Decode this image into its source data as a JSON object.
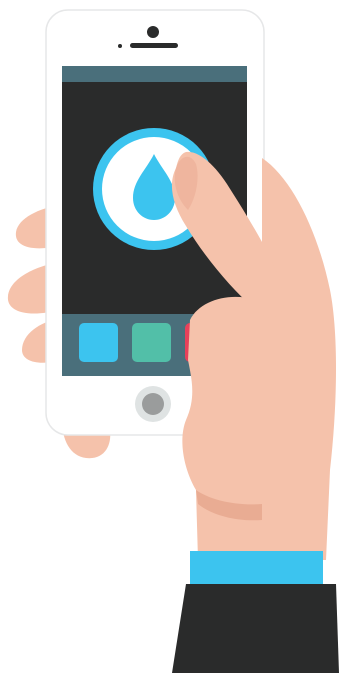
{
  "illustration": {
    "colors": {
      "background": "#ffffff",
      "phone_body": "#ffffff",
      "phone_outline": "#e6e7e8",
      "screen": "#2a2b2b",
      "status_bar": "#4a6f7b",
      "dock": "#4a6f7b",
      "accent_ring": "#3cc4ef",
      "drop": "#3cc4ef",
      "app_blue": "#3cc4ef",
      "app_green": "#52bfa8",
      "app_red": "#e8415a",
      "home_button_ring": "#dfe3e3",
      "home_button": "#9a9c9c",
      "skin": "#f5c2ab",
      "skin_shadow": "#e9ac93",
      "cuff": "#3cc4ef",
      "sleeve": "#2a2b2b"
    },
    "icons": {
      "app_icon": "water-drop-icon",
      "dock_apps": [
        "blue-app-icon",
        "green-app-icon",
        "red-app-icon"
      ]
    }
  }
}
